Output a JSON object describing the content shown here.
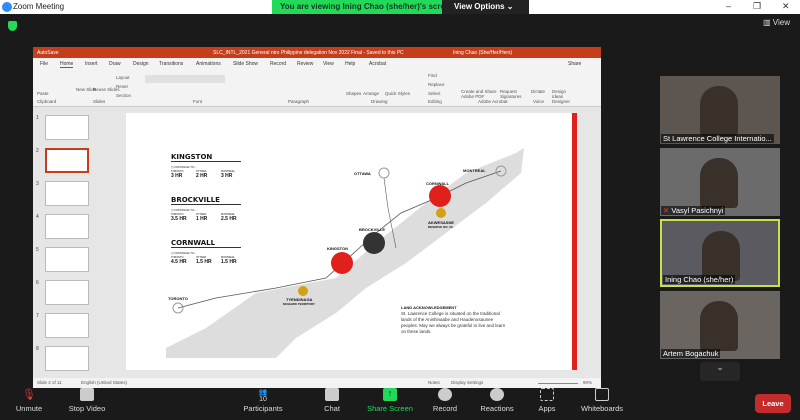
{
  "zoom": {
    "title": "Zoom Meeting",
    "banner": "You are viewing Ining Chao (she/her)'s screen",
    "view_options": "View Options",
    "view": "View"
  },
  "ppt": {
    "title": "SLC_INTL_2021 General  ntro Philippine delegation Nov 2022 Final - Saved to this PC",
    "autosave": "AutoSave",
    "user": "Ining Chao (She/Her/Hers)",
    "tabs": [
      "File",
      "Home",
      "Insert",
      "Draw",
      "Design",
      "Transitions",
      "Animations",
      "Slide Show",
      "Record",
      "Review",
      "View",
      "Help",
      "Acrobat"
    ],
    "share": "Share",
    "groups": [
      "Clipboard",
      "Slides",
      "Font",
      "Paragraph",
      "Drawing",
      "Editing",
      "Adobe Acrobat",
      "Voice",
      "Designer"
    ],
    "ribbon_buttons": [
      "Paste",
      "New Slide",
      "Reuse Slides",
      "Layout",
      "Reset",
      "Section",
      "Shapes",
      "Arrange",
      "Quick Styles",
      "Find",
      "Replace",
      "Select",
      "Create and Share Adobe PDF",
      "Request Signatures",
      "Dictate",
      "Design Ideas"
    ],
    "status": {
      "slide": "Slide 2 of 11",
      "lang": "English (United States)",
      "notes": "Notes",
      "display": "Display Settings",
      "zoom": "90%"
    },
    "thumb_numbers": [
      "1",
      "2",
      "3",
      "4",
      "5",
      "6",
      "7",
      "8"
    ]
  },
  "slide": {
    "cities": [
      {
        "name": "KINGSTON",
        "sub": "DISTANCE TO...",
        "times": [
          [
            "TORONTO",
            "3 HR"
          ],
          [
            "OTTAWA",
            "2 HR"
          ],
          [
            "MONTREAL",
            "3 HR"
          ]
        ]
      },
      {
        "name": "BROCKVILLE",
        "sub": "DISTANCE TO...",
        "times": [
          [
            "TORONTO",
            "3.5 HR"
          ],
          [
            "OTTAWA",
            "1 HR"
          ],
          [
            "MONTREAL",
            "2.5 HR"
          ]
        ]
      },
      {
        "name": "CORNWALL",
        "sub": "DISTANCE TO...",
        "times": [
          [
            "TORONTO",
            "4.5 HR"
          ],
          [
            "OTTAWA",
            "1.5 HR"
          ],
          [
            "MONTREAL",
            "1.5 HR"
          ]
        ]
      }
    ],
    "map": {
      "ottawa": "OTTAWA",
      "montreal": "MONTREAL",
      "cornwall": "CORNWALL",
      "akwesasne": "AKWESASNE",
      "akwesasne_sub": "RESERVE NO. 59",
      "brockville": "BROCKVILLE",
      "kingston": "KINGSTON",
      "tyendinaga": "TYENDINAGA",
      "tyendinaga_sub": "MOHAWK TERRITORY",
      "toronto": "TORONTO"
    },
    "land_title": "LAND ACKNOWLEDGEMENT",
    "land_text": "St. Lawrence College is situated on the traditional lands of the Anishinaabe and Haudenosaunee peoples. May we always be grateful to live and learn on these lands."
  },
  "participants": [
    {
      "name": "St Lawrence College Internatio..."
    },
    {
      "name": "Vasyl Pasichnyi",
      "muted": true
    },
    {
      "name": "Ining Chao (she/her)",
      "active": true
    },
    {
      "name": "Artem Bogachuk"
    }
  ],
  "toolbar": {
    "unmute": "Unmute",
    "stop_video": "Stop Video",
    "participants": "Participants",
    "participant_count": "10",
    "chat": "Chat",
    "share": "Share Screen",
    "record": "Record",
    "reactions": "Reactions",
    "apps": "Apps",
    "whiteboards": "Whiteboards",
    "leave": "Leave"
  },
  "colors": {
    "zoom_green": "#23d959",
    "ppt_red": "#c43e1c",
    "leave": "#c42b2b",
    "slide_red": "#e0201b"
  }
}
